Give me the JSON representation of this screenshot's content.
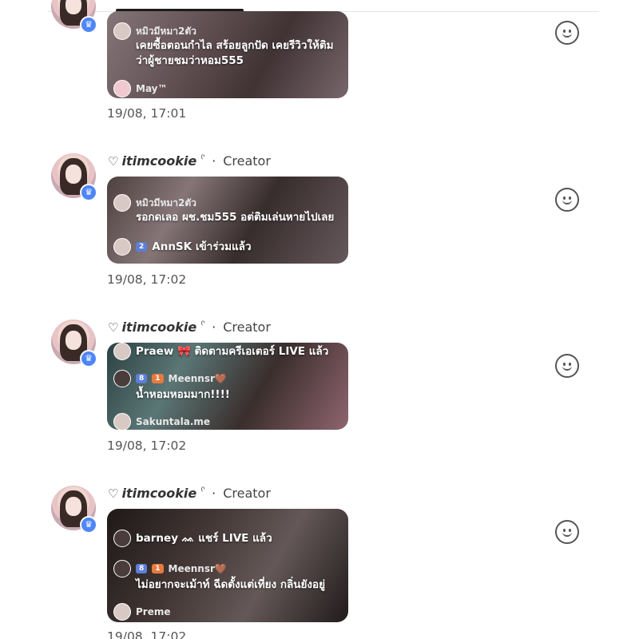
{
  "posts": [
    {
      "username": "itimcookie",
      "role": "Creator",
      "timestamp": "19/08, 17:01",
      "lines": [
        {
          "name": "หมิวมีหมา2ตัว",
          "badges": [],
          "text": "เคยซื้อตอนกำไล สร้อยลูกปัด เคยรีวิวให้ติม ว่าผู้ชายชมว่าหอม555"
        },
        {
          "name": "May™",
          "badges": [],
          "text": ""
        }
      ]
    },
    {
      "username": "itimcookie",
      "role": "Creator",
      "timestamp": "19/08, 17:02",
      "lines": [
        {
          "name": "หมิวมีหมา2ตัว",
          "badges": [],
          "text": "รอกดเลอ ผช.ชม555 อต่ติมเล่นหายไปเลย"
        },
        {
          "name": "AnnSK เข้าร่วมแล้ว",
          "badges": [
            "2"
          ],
          "text": ""
        }
      ]
    },
    {
      "username": "itimcookie",
      "role": "Creator",
      "timestamp": "19/08, 17:02",
      "lines": [
        {
          "name": "Praew 🎀 ติดตามครีเอเตอร์ LIVE แล้ว",
          "badges": [],
          "text": ""
        },
        {
          "name": "Meennsr🤎",
          "badges": [
            "8",
            "1"
          ],
          "text": "น้ำหอมหอมมาก!!!!"
        },
        {
          "name": "Sakuntala.me",
          "badges": [],
          "text": ""
        }
      ]
    },
    {
      "username": "itimcookie",
      "role": "Creator",
      "timestamp": "19/08, 17:02",
      "lines": [
        {
          "name": "barney ᨐ แชร์ LIVE แล้ว",
          "badges": [],
          "text": ""
        },
        {
          "name": "Meennsr🤎",
          "badges": [
            "8",
            "1"
          ],
          "text": "ไม่อยากจะเม้าท์ ฉีดตั้งแต่เที่ยง กลิ่นยังอยู่"
        },
        {
          "name": "Preme",
          "badges": [],
          "text": ""
        }
      ]
    }
  ],
  "icons": {
    "heart": "heart-outline-icon",
    "crown": "crown-badge-icon",
    "react": "smiley-react-icon"
  },
  "colors": {
    "crown_badge": "#4f86f7",
    "level_badge": "#5c7fd6",
    "fan_badge": "#e77a3d"
  }
}
